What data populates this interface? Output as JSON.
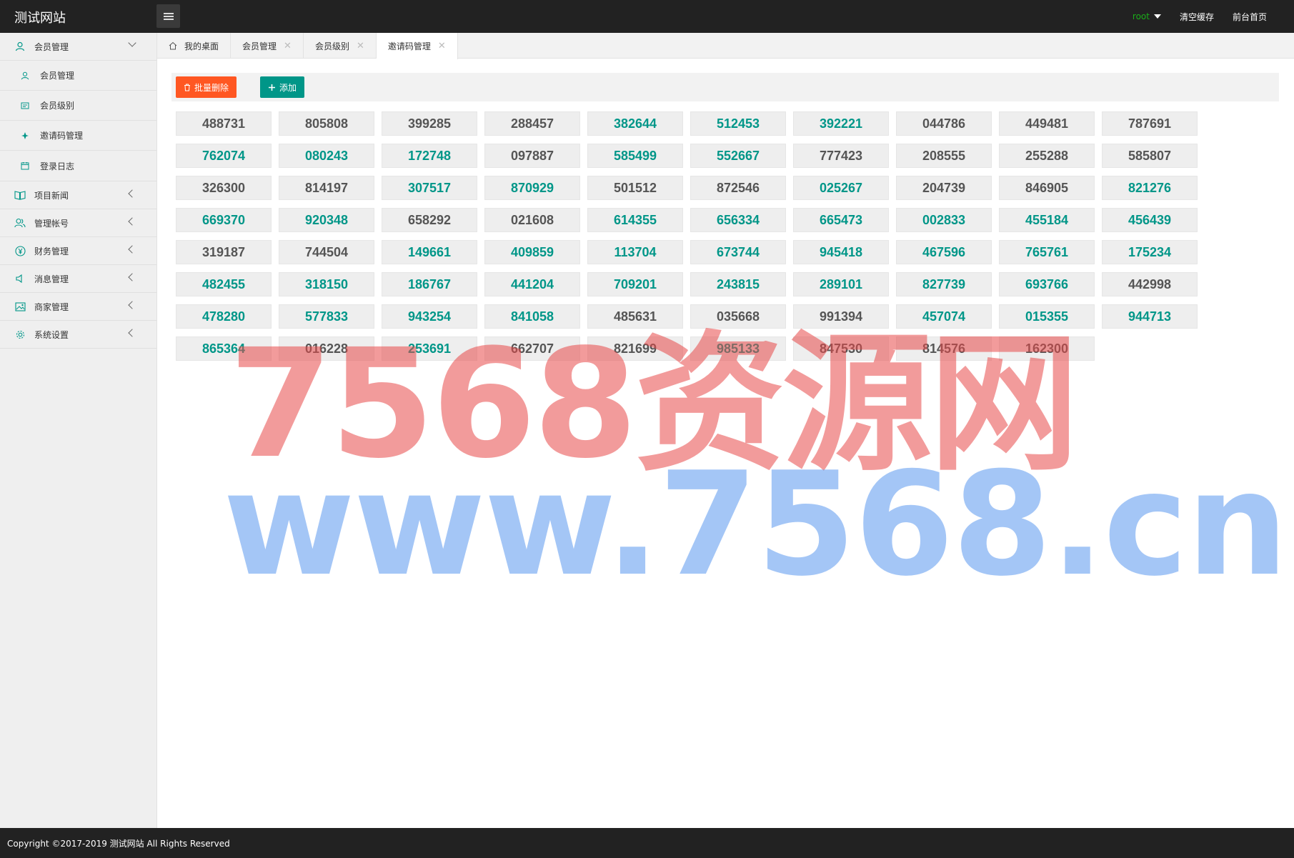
{
  "header": {
    "logo": "测试网站",
    "user": "root",
    "clear_cache": "清空缓存",
    "front_home": "前台首页"
  },
  "sidebar": {
    "groups": [
      {
        "label": "会员管理",
        "icon": "user-icon",
        "expanded": true,
        "items": [
          {
            "label": "会员管理",
            "icon": "user-icon"
          },
          {
            "label": "会员级别",
            "icon": "level-icon"
          },
          {
            "label": "邀请码管理",
            "icon": "invite-icon"
          },
          {
            "label": "登录日志",
            "icon": "log-icon"
          }
        ]
      },
      {
        "label": "项目新闻",
        "icon": "book-icon"
      },
      {
        "label": "管理帐号",
        "icon": "users-icon"
      },
      {
        "label": "财务管理",
        "icon": "yen-icon"
      },
      {
        "label": "消息管理",
        "icon": "speaker-icon"
      },
      {
        "label": "商家管理",
        "icon": "image-icon"
      },
      {
        "label": "系统设置",
        "icon": "gear-icon"
      }
    ]
  },
  "tabs": [
    {
      "label": "我的桌面",
      "closable": false
    },
    {
      "label": "会员管理",
      "closable": true
    },
    {
      "label": "会员级别",
      "closable": true
    },
    {
      "label": "邀请码管理",
      "closable": true,
      "active": true
    }
  ],
  "toolbar": {
    "batch_delete": "批量删除",
    "add": "添加"
  },
  "colors": {
    "used": "#555555",
    "unused": "#009688",
    "danger": "#ff5722",
    "primary": "#009688"
  },
  "codes": [
    {
      "code": "488731",
      "used": true
    },
    {
      "code": "805808",
      "used": true
    },
    {
      "code": "399285",
      "used": true
    },
    {
      "code": "288457",
      "used": true
    },
    {
      "code": "382644",
      "used": false
    },
    {
      "code": "512453",
      "used": false
    },
    {
      "code": "392221",
      "used": false
    },
    {
      "code": "044786",
      "used": true
    },
    {
      "code": "449481",
      "used": true
    },
    {
      "code": "787691",
      "used": true
    },
    {
      "code": "762074",
      "used": false
    },
    {
      "code": "080243",
      "used": false
    },
    {
      "code": "172748",
      "used": false
    },
    {
      "code": "097887",
      "used": true
    },
    {
      "code": "585499",
      "used": false
    },
    {
      "code": "552667",
      "used": false
    },
    {
      "code": "777423",
      "used": true
    },
    {
      "code": "208555",
      "used": true
    },
    {
      "code": "255288",
      "used": true
    },
    {
      "code": "585807",
      "used": true
    },
    {
      "code": "326300",
      "used": true
    },
    {
      "code": "814197",
      "used": true
    },
    {
      "code": "307517",
      "used": false
    },
    {
      "code": "870929",
      "used": false
    },
    {
      "code": "501512",
      "used": true
    },
    {
      "code": "872546",
      "used": true
    },
    {
      "code": "025267",
      "used": false
    },
    {
      "code": "204739",
      "used": true
    },
    {
      "code": "846905",
      "used": true
    },
    {
      "code": "821276",
      "used": false
    },
    {
      "code": "669370",
      "used": false
    },
    {
      "code": "920348",
      "used": false
    },
    {
      "code": "658292",
      "used": true
    },
    {
      "code": "021608",
      "used": true
    },
    {
      "code": "614355",
      "used": false
    },
    {
      "code": "656334",
      "used": false
    },
    {
      "code": "665473",
      "used": false
    },
    {
      "code": "002833",
      "used": false
    },
    {
      "code": "455184",
      "used": false
    },
    {
      "code": "456439",
      "used": false
    },
    {
      "code": "319187",
      "used": true
    },
    {
      "code": "744504",
      "used": true
    },
    {
      "code": "149661",
      "used": false
    },
    {
      "code": "409859",
      "used": false
    },
    {
      "code": "113704",
      "used": false
    },
    {
      "code": "673744",
      "used": false
    },
    {
      "code": "945418",
      "used": false
    },
    {
      "code": "467596",
      "used": false
    },
    {
      "code": "765761",
      "used": false
    },
    {
      "code": "175234",
      "used": false
    },
    {
      "code": "482455",
      "used": false
    },
    {
      "code": "318150",
      "used": false
    },
    {
      "code": "186767",
      "used": false
    },
    {
      "code": "441204",
      "used": false
    },
    {
      "code": "709201",
      "used": false
    },
    {
      "code": "243815",
      "used": false
    },
    {
      "code": "289101",
      "used": false
    },
    {
      "code": "827739",
      "used": false
    },
    {
      "code": "693766",
      "used": false
    },
    {
      "code": "442998",
      "used": true
    },
    {
      "code": "478280",
      "used": false
    },
    {
      "code": "577833",
      "used": false
    },
    {
      "code": "943254",
      "used": false
    },
    {
      "code": "841058",
      "used": false
    },
    {
      "code": "485631",
      "used": true
    },
    {
      "code": "035668",
      "used": true
    },
    {
      "code": "991394",
      "used": true
    },
    {
      "code": "457074",
      "used": false
    },
    {
      "code": "015355",
      "used": false
    },
    {
      "code": "944713",
      "used": false
    },
    {
      "code": "865364",
      "used": false
    },
    {
      "code": "016228",
      "used": true
    },
    {
      "code": "253691",
      "used": false
    },
    {
      "code": "662707",
      "used": true
    },
    {
      "code": "821699",
      "used": true
    },
    {
      "code": "985133",
      "used": false
    },
    {
      "code": "847530",
      "used": true
    },
    {
      "code": "814576",
      "used": true
    },
    {
      "code": "162300",
      "used": true
    }
  ],
  "watermark": {
    "line1": "7568资源网",
    "line2": "www.7568.cn"
  },
  "footer": {
    "copyright": "Copyright ©2017-2019 测试网站 All Rights Reserved"
  }
}
